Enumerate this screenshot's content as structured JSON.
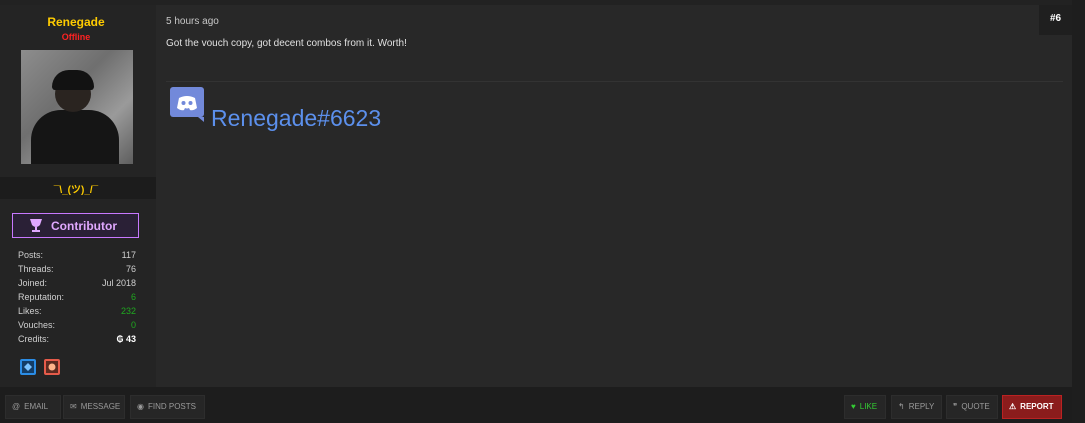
{
  "user": {
    "username": "Renegade",
    "status": "Offline",
    "tagline": "¯\\_(ツ)_/¯",
    "badge_label": "Contributor",
    "stats": [
      {
        "key": "Posts:",
        "value": "117"
      },
      {
        "key": "Threads:",
        "value": "76"
      },
      {
        "key": "Joined:",
        "value": "Jul 2018"
      },
      {
        "key": "Reputation:",
        "value": "6"
      },
      {
        "key": "Likes:",
        "value": "232"
      },
      {
        "key": "Vouches:",
        "value": "0"
      },
      {
        "key": "Credits:",
        "value": "₲ 43"
      }
    ]
  },
  "post": {
    "time": "5 hours ago",
    "number": "#6",
    "message": "Got the vouch copy, got decent combos from it. Worth!",
    "discord_name": "Renegade#6623"
  },
  "footer": {
    "email": "EMAIL",
    "message": "MESSAGE",
    "find_posts": "FIND POSTS",
    "like": "LIKE",
    "reply": "REPLY",
    "quote": "QUOTE",
    "report": "REPORT"
  },
  "colors": {
    "username": "#ffcc00",
    "offline": "#ff2222",
    "contributor": "#c878ff",
    "discord": "#5c90ec",
    "report": "#8b1c1c",
    "like": "#33cc33"
  }
}
